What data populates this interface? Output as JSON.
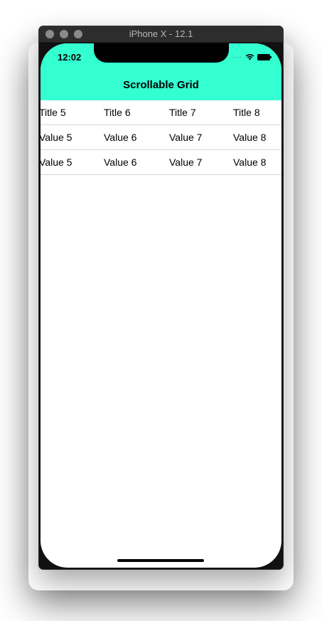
{
  "window": {
    "title": "iPhone X - 12.1"
  },
  "status_bar": {
    "time": "12:02"
  },
  "nav": {
    "title": "Scrollable Grid"
  },
  "grid": {
    "rows": [
      [
        "Title 5",
        "Title 6",
        "Title 7",
        "Title 8"
      ],
      [
        "Value 5",
        "Value 6",
        "Value 7",
        "Value 8"
      ],
      [
        "Value 5",
        "Value 6",
        "Value 7",
        "Value 8"
      ]
    ]
  },
  "colors": {
    "header_bg": "#33ffd1",
    "text": "#000000",
    "divider": "#d6d6d6"
  }
}
